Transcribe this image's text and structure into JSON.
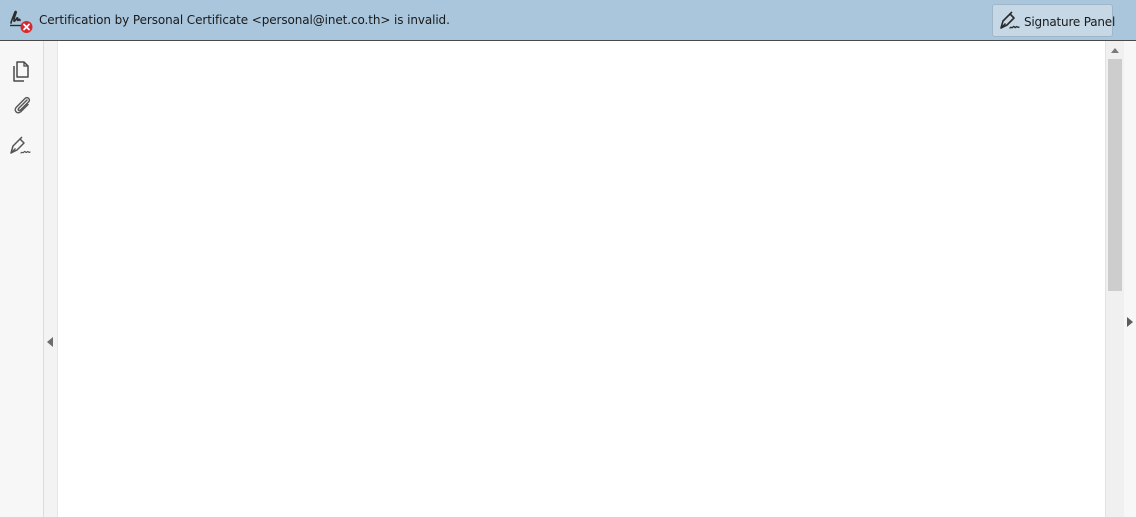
{
  "banner": {
    "message": "Certification by Personal Certificate <personal@inet.co.th> is invalid.",
    "status_icon": "signature-invalid-icon",
    "background_color": "#a9c6dc",
    "error_color": "#d9272e",
    "signature_panel_button": {
      "label": "Signature Panel",
      "icon": "signature-pen-icon"
    }
  },
  "left_rail": {
    "items": [
      {
        "id": "pages",
        "icon": "page-thumbnails-icon"
      },
      {
        "id": "attachments",
        "icon": "paperclip-icon"
      },
      {
        "id": "signatures",
        "icon": "signature-pen-icon"
      }
    ]
  },
  "document": {
    "background_color": "#ffffff"
  }
}
